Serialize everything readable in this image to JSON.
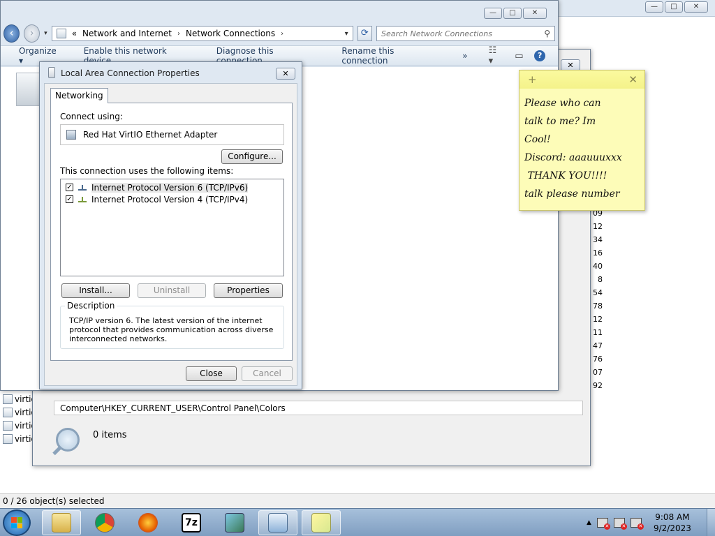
{
  "background_window": {
    "status": "0 / 26 object(s) selected",
    "left_items": [
      "virtio",
      "virtio",
      "virtio",
      "virtio"
    ],
    "numbers": [
      "09",
      "12",
      "34",
      "16",
      "40",
      "8",
      "54",
      "78",
      "12",
      "11",
      "47",
      "76",
      "07",
      "92"
    ]
  },
  "registry_window": {
    "address": "Computer\\HKEY_CURRENT_USER\\Control Panel\\Colors",
    "footer_items": "0 items",
    "close_glyph": "✕"
  },
  "network_window": {
    "breadcrumb": {
      "prefix": "«",
      "items": [
        "Network and Internet",
        "Network Connections"
      ],
      "sep": "›",
      "dropdown": "▾"
    },
    "search_placeholder": "Search Network Connections",
    "commands": [
      "Organize ▾",
      "Enable this network device",
      "Diagnose this connection",
      "Rename this connection",
      "»"
    ],
    "help": "?",
    "caption_buttons": {
      "minimize": "—",
      "maximize": "□",
      "close": "✕"
    }
  },
  "properties_dialog": {
    "title": "Local Area Connection Properties",
    "close_glyph": "✕",
    "tab": "Networking",
    "connect_using_label": "Connect using:",
    "adapter": "Red Hat VirtIO Ethernet Adapter",
    "configure_label": "Configure...",
    "items_label": "This connection uses the following items:",
    "items": [
      {
        "label": "Internet Protocol Version 6 (TCP/IPv6)",
        "checked": true
      },
      {
        "label": "Internet Protocol Version 4 (TCP/IPv4)",
        "checked": true
      }
    ],
    "check_glyph": "✓",
    "install_label": "Install...",
    "uninstall_label": "Uninstall",
    "properties_label": "Properties",
    "description_legend": "Description",
    "description": "TCP/IP version 6. The latest version of the internet protocol that provides communication across diverse interconnected networks.",
    "close_label": "Close",
    "cancel_label": "Cancel"
  },
  "sticky_note": {
    "add_glyph": "+",
    "close_glyph": "✕",
    "text": "Please who can\ntalk to me? Im\nCool!\nDiscord: aaauuuxxx\n THANK YOU!!!!\ntalk please number"
  },
  "taskbar": {
    "time": "9:08 AM",
    "date": "9/2/2023",
    "apps": [
      "explorer-icon",
      "chrome-icon",
      "firefox-icon",
      "7zip-icon",
      "setup-icon",
      "network-connections-icon",
      "sticky-notes-icon"
    ],
    "seven_zip_label": "7z",
    "tray_arrow": "▲"
  },
  "colors": {
    "accent": "#2c5ea3",
    "sticky": "#fdfcb8",
    "taskbar": "#8fabca"
  }
}
